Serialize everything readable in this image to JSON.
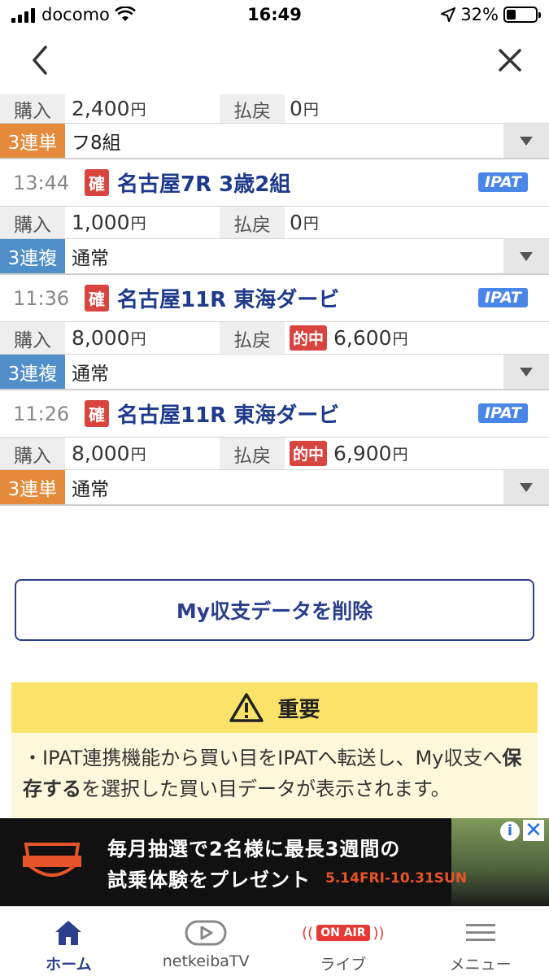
{
  "status_bar": {
    "carrier": "docomo",
    "time": "16:49",
    "battery": "32%",
    "battery_level": 0.32
  },
  "nav": {
    "back_icon": "chevron-left-icon",
    "close_icon": "close-icon"
  },
  "labels": {
    "buy": "購入",
    "return": "払戻",
    "yen": "円",
    "confirmed": "確",
    "hit": "的中",
    "ipat": "IPAT"
  },
  "entries": [
    {
      "buy_amount": "2,400",
      "return_amount": "0",
      "bet_type": "3連単",
      "bet_type_color": "#e48a3a",
      "bet_detail": "フ8組"
    },
    {
      "time": "13:44",
      "race": "名古屋7R 3歳2組",
      "buy_amount": "1,000",
      "return_amount": "0",
      "bet_type": "3連複",
      "bet_type_color": "#4f8ec9",
      "bet_detail": "通常"
    },
    {
      "time": "11:36",
      "race": "名古屋11R 東海ダービ",
      "buy_amount": "8,000",
      "return_amount": "6,600",
      "hit": true,
      "bet_type": "3連複",
      "bet_type_color": "#4f8ec9",
      "bet_detail": "通常"
    },
    {
      "time": "11:26",
      "race": "名古屋11R 東海ダービ",
      "buy_amount": "8,000",
      "return_amount": "6,900",
      "hit": true,
      "bet_type": "3連単",
      "bet_type_color": "#e48a3a",
      "bet_detail": "通常"
    }
  ],
  "delete_button": "My収支データを削除",
  "notice": {
    "title": "重要",
    "body_prefix": "・IPAT連携機能から買い目をIPATへ転送し、My収支へ",
    "body_bold": "保存する",
    "body_suffix": "を選択した買い目データが表示されます。"
  },
  "ad": {
    "line1": "毎月抽選で2名様に最長3週間の",
    "line2": "試乗体験をプレゼント",
    "date": "5.14FRI-10.31SUN",
    "info": "i",
    "close": "✕"
  },
  "tabs": [
    {
      "label": "ホーム",
      "icon": "home-icon",
      "active": true
    },
    {
      "label": "netkeibaTV",
      "icon": "tv-play-icon",
      "active": false
    },
    {
      "label": "ライブ",
      "icon": "on-air-icon",
      "badge": "ON AIR",
      "active": false
    },
    {
      "label": "メニュー",
      "icon": "menu-icon",
      "active": false
    }
  ],
  "colors": {
    "accent": "#2b3f8c",
    "race_name": "#1e3a8a",
    "hit": "#d8453f",
    "ipat": "#4a86e8",
    "notice_head": "#fbe36a"
  }
}
